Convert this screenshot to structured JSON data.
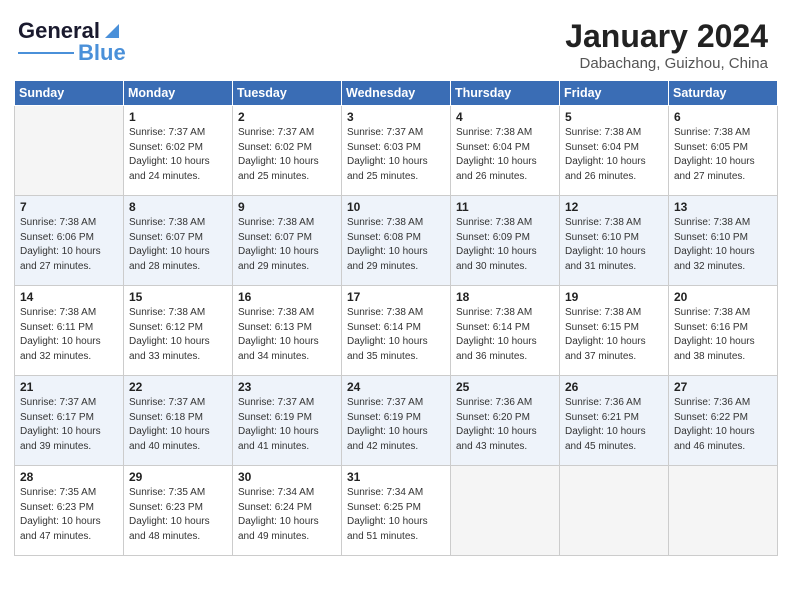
{
  "header": {
    "logo_line1": "General",
    "logo_line2": "Blue",
    "title": "January 2024",
    "subtitle": "Dabachang, Guizhou, China"
  },
  "days_of_week": [
    "Sunday",
    "Monday",
    "Tuesday",
    "Wednesday",
    "Thursday",
    "Friday",
    "Saturday"
  ],
  "weeks": [
    [
      {
        "num": "",
        "empty": true
      },
      {
        "num": "1",
        "sunrise": "7:37 AM",
        "sunset": "6:02 PM",
        "daylight": "10 hours and 24 minutes."
      },
      {
        "num": "2",
        "sunrise": "7:37 AM",
        "sunset": "6:02 PM",
        "daylight": "10 hours and 25 minutes."
      },
      {
        "num": "3",
        "sunrise": "7:37 AM",
        "sunset": "6:03 PM",
        "daylight": "10 hours and 25 minutes."
      },
      {
        "num": "4",
        "sunrise": "7:38 AM",
        "sunset": "6:04 PM",
        "daylight": "10 hours and 26 minutes."
      },
      {
        "num": "5",
        "sunrise": "7:38 AM",
        "sunset": "6:04 PM",
        "daylight": "10 hours and 26 minutes."
      },
      {
        "num": "6",
        "sunrise": "7:38 AM",
        "sunset": "6:05 PM",
        "daylight": "10 hours and 27 minutes."
      }
    ],
    [
      {
        "num": "7",
        "sunrise": "7:38 AM",
        "sunset": "6:06 PM",
        "daylight": "10 hours and 27 minutes."
      },
      {
        "num": "8",
        "sunrise": "7:38 AM",
        "sunset": "6:07 PM",
        "daylight": "10 hours and 28 minutes."
      },
      {
        "num": "9",
        "sunrise": "7:38 AM",
        "sunset": "6:07 PM",
        "daylight": "10 hours and 29 minutes."
      },
      {
        "num": "10",
        "sunrise": "7:38 AM",
        "sunset": "6:08 PM",
        "daylight": "10 hours and 29 minutes."
      },
      {
        "num": "11",
        "sunrise": "7:38 AM",
        "sunset": "6:09 PM",
        "daylight": "10 hours and 30 minutes."
      },
      {
        "num": "12",
        "sunrise": "7:38 AM",
        "sunset": "6:10 PM",
        "daylight": "10 hours and 31 minutes."
      },
      {
        "num": "13",
        "sunrise": "7:38 AM",
        "sunset": "6:10 PM",
        "daylight": "10 hours and 32 minutes."
      }
    ],
    [
      {
        "num": "14",
        "sunrise": "7:38 AM",
        "sunset": "6:11 PM",
        "daylight": "10 hours and 32 minutes."
      },
      {
        "num": "15",
        "sunrise": "7:38 AM",
        "sunset": "6:12 PM",
        "daylight": "10 hours and 33 minutes."
      },
      {
        "num": "16",
        "sunrise": "7:38 AM",
        "sunset": "6:13 PM",
        "daylight": "10 hours and 34 minutes."
      },
      {
        "num": "17",
        "sunrise": "7:38 AM",
        "sunset": "6:14 PM",
        "daylight": "10 hours and 35 minutes."
      },
      {
        "num": "18",
        "sunrise": "7:38 AM",
        "sunset": "6:14 PM",
        "daylight": "10 hours and 36 minutes."
      },
      {
        "num": "19",
        "sunrise": "7:38 AM",
        "sunset": "6:15 PM",
        "daylight": "10 hours and 37 minutes."
      },
      {
        "num": "20",
        "sunrise": "7:38 AM",
        "sunset": "6:16 PM",
        "daylight": "10 hours and 38 minutes."
      }
    ],
    [
      {
        "num": "21",
        "sunrise": "7:37 AM",
        "sunset": "6:17 PM",
        "daylight": "10 hours and 39 minutes."
      },
      {
        "num": "22",
        "sunrise": "7:37 AM",
        "sunset": "6:18 PM",
        "daylight": "10 hours and 40 minutes."
      },
      {
        "num": "23",
        "sunrise": "7:37 AM",
        "sunset": "6:19 PM",
        "daylight": "10 hours and 41 minutes."
      },
      {
        "num": "24",
        "sunrise": "7:37 AM",
        "sunset": "6:19 PM",
        "daylight": "10 hours and 42 minutes."
      },
      {
        "num": "25",
        "sunrise": "7:36 AM",
        "sunset": "6:20 PM",
        "daylight": "10 hours and 43 minutes."
      },
      {
        "num": "26",
        "sunrise": "7:36 AM",
        "sunset": "6:21 PM",
        "daylight": "10 hours and 45 minutes."
      },
      {
        "num": "27",
        "sunrise": "7:36 AM",
        "sunset": "6:22 PM",
        "daylight": "10 hours and 46 minutes."
      }
    ],
    [
      {
        "num": "28",
        "sunrise": "7:35 AM",
        "sunset": "6:23 PM",
        "daylight": "10 hours and 47 minutes."
      },
      {
        "num": "29",
        "sunrise": "7:35 AM",
        "sunset": "6:23 PM",
        "daylight": "10 hours and 48 minutes."
      },
      {
        "num": "30",
        "sunrise": "7:34 AM",
        "sunset": "6:24 PM",
        "daylight": "10 hours and 49 minutes."
      },
      {
        "num": "31",
        "sunrise": "7:34 AM",
        "sunset": "6:25 PM",
        "daylight": "10 hours and 51 minutes."
      },
      {
        "num": "",
        "empty": true
      },
      {
        "num": "",
        "empty": true
      },
      {
        "num": "",
        "empty": true
      }
    ]
  ]
}
